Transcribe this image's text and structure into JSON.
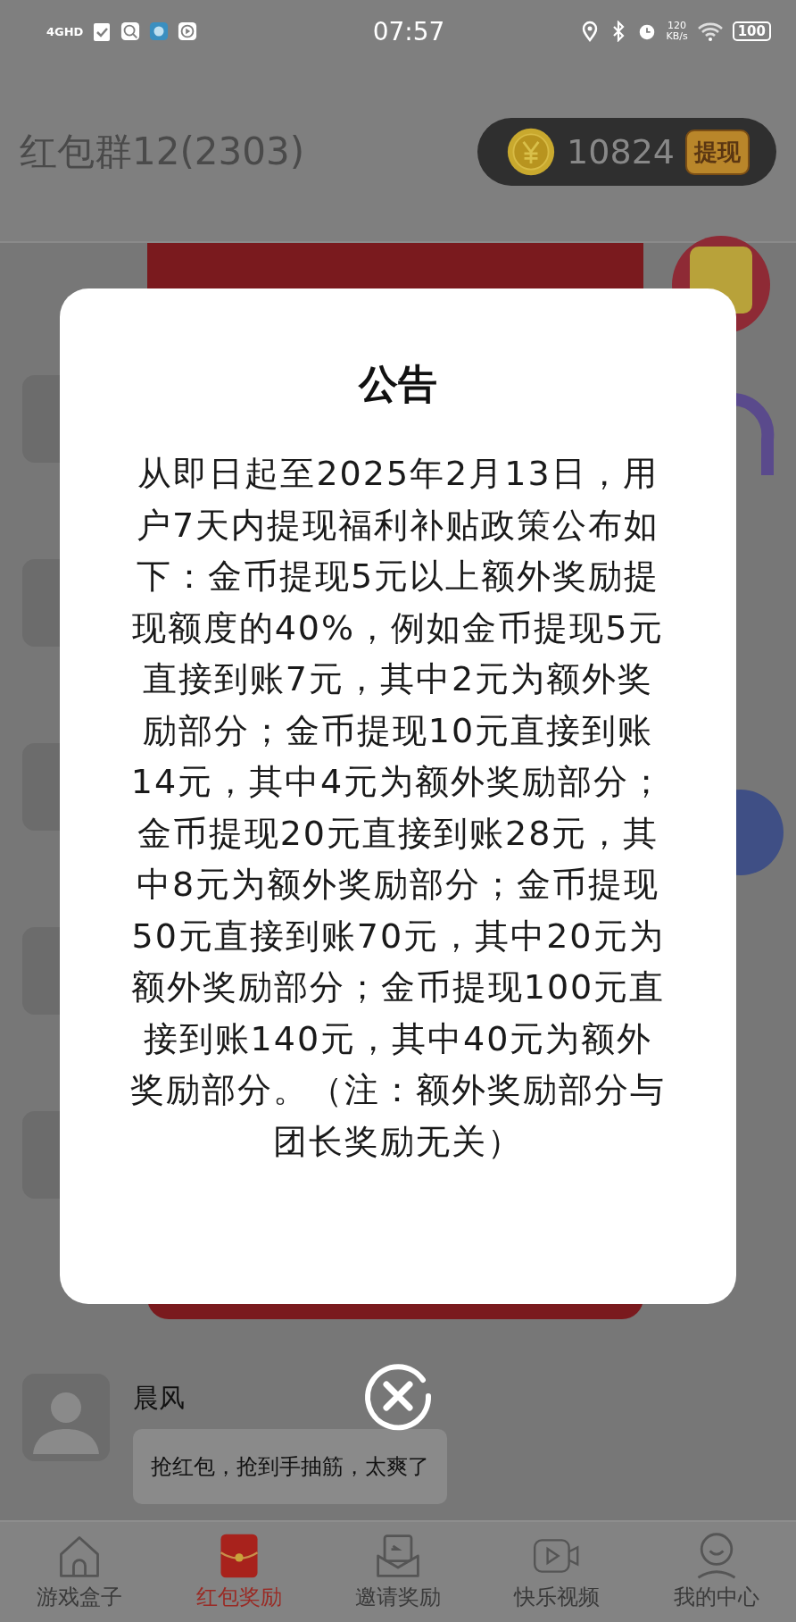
{
  "status_bar": {
    "network": "4GHD",
    "time": "07:57",
    "speed": "120",
    "speed_unit": "KB/s",
    "battery": "100"
  },
  "header": {
    "title": "红包群12(2303)",
    "coins": "10824",
    "withdraw_button": "提现"
  },
  "dialog": {
    "title": "公告",
    "body": "从即日起至2025年2月13日，用户7天内提现福利补贴政策公布如下：金币提现5元以上额外奖励提现额度的40%，例如金币提现5元直接到账7元，其中2元为额外奖励部分；金币提现10元直接到账14元，其中4元为额外奖励部分；金币提现20元直接到账28元，其中8元为额外奖励部分；金币提现50元直接到账70元，其中20元为额外奖励部分；金币提现100元直接到账140元，其中40元为额外奖励部分。（注：额外奖励部分与团长奖励无关）"
  },
  "chat": {
    "sender": "晨风",
    "message": "抢红包，抢到手抽筋，太爽了"
  },
  "tabs": [
    {
      "label": "游戏盒子",
      "kind": "home",
      "selected": false
    },
    {
      "label": "红包奖励",
      "kind": "packet",
      "selected": true
    },
    {
      "label": "邀请奖励",
      "kind": "invite",
      "selected": false
    },
    {
      "label": "快乐视频",
      "kind": "video",
      "selected": false
    },
    {
      "label": "我的中心",
      "kind": "user",
      "selected": false
    }
  ]
}
